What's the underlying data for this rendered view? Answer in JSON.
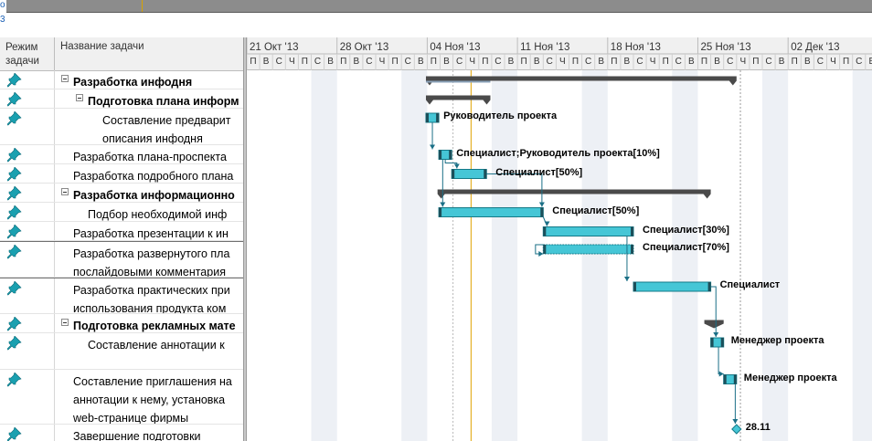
{
  "timeline": {
    "marker": "o"
  },
  "grid": {
    "header": {
      "mode": "Режим\nзадачи",
      "name": "Название задачи"
    },
    "rows": [
      {
        "name": "Разработка инфодня",
        "summary": true
      },
      {
        "name": "Подготовка плана информ",
        "summary": true
      },
      {
        "name": "Составление предварит\nописания инфодня",
        "summary": false
      },
      {
        "name": "Разработка плана-проспекта",
        "summary": false
      },
      {
        "name": "Разработка подробного плана",
        "summary": false
      },
      {
        "name": "Разработка информационно",
        "summary": true
      },
      {
        "name": "Подбор необходимой инф",
        "summary": false
      },
      {
        "name": "Разработка презентации к ин",
        "summary": false
      },
      {
        "name": "Разработка развернутого пла\nпослайдовыми комментария",
        "summary": false
      },
      {
        "name": "Разработка практических при\nиспользования продукта ком",
        "summary": false
      },
      {
        "name": "Подготовка рекламных мате",
        "summary": true
      },
      {
        "name": "Составление аннотации к",
        "summary": false
      },
      {
        "name": "Составление приглашения на\nаннотации к нему, установка\nweb-странице фирмы",
        "summary": false
      },
      {
        "name": "Завершение подготовки",
        "summary": false
      }
    ]
  },
  "chart": {
    "weeks": [
      "21 Окт '13",
      "28 Окт '13",
      "04 Ноя '13",
      "11 Ноя '13",
      "18 Ноя '13",
      "25 Ноя '13",
      "02 Дек '13"
    ],
    "day_letters": [
      "П",
      "В",
      "С",
      "Ч",
      "П",
      "С",
      "В"
    ],
    "milestone_label": "28.11",
    "resource_labels": [
      "Руководитель проекта",
      "Специалист;Руководитель проекта[10%]",
      "Специалист[50%]",
      "Специалист[50%]",
      "Специалист[30%]",
      "Специалист[70%]",
      "Специалист",
      "Менеджер проекта",
      "Менеджер проекта"
    ]
  },
  "colors": {
    "task_bar": "#45c6d6",
    "summary_bar": "#4a4a4a",
    "weekend_shade": "#edf0f5",
    "status_line": "#e0a200",
    "pin_icon": "#1aa0b0"
  }
}
